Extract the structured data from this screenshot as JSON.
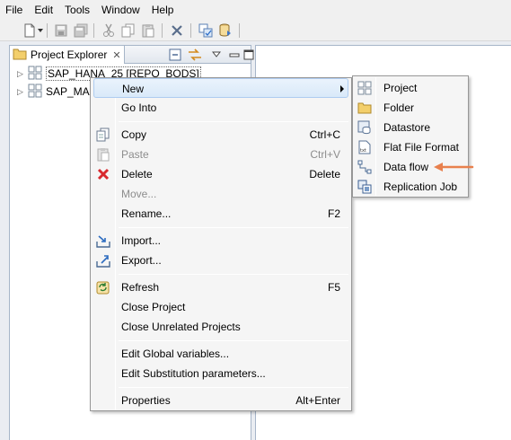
{
  "menubar": {
    "items": [
      "File",
      "Edit",
      "Tools",
      "Window",
      "Help"
    ]
  },
  "toolbar": {
    "icons": [
      "new-icon",
      "save-icon",
      "save-all-icon",
      "cut-icon",
      "copy-icon",
      "paste-icon",
      "delete-icon",
      "validate-icon",
      "database-icon"
    ]
  },
  "explorer": {
    "tab_label": "Project Explorer",
    "tree": [
      {
        "label": "SAP_HANA_25 [REPO_BODS]",
        "selected": true
      },
      {
        "label": "SAP_MA"
      }
    ]
  },
  "context_menu": {
    "items": {
      "new": {
        "label": "New"
      },
      "go_into": {
        "label": "Go Into"
      },
      "copy": {
        "label": "Copy",
        "shortcut": "Ctrl+C"
      },
      "paste": {
        "label": "Paste",
        "shortcut": "Ctrl+V"
      },
      "delete": {
        "label": "Delete",
        "shortcut": "Delete"
      },
      "move": {
        "label": "Move..."
      },
      "rename": {
        "label": "Rename...",
        "shortcut": "F2"
      },
      "import": {
        "label": "Import..."
      },
      "export": {
        "label": "Export..."
      },
      "refresh": {
        "label": "Refresh",
        "shortcut": "F5"
      },
      "close_project": {
        "label": "Close Project"
      },
      "close_unrelated": {
        "label": "Close Unrelated Projects"
      },
      "edit_global": {
        "label": "Edit Global variables..."
      },
      "edit_substitution": {
        "label": "Edit Substitution parameters..."
      },
      "properties": {
        "label": "Properties",
        "shortcut": "Alt+Enter"
      }
    }
  },
  "submenu": {
    "items": {
      "project": "Project",
      "folder": "Folder",
      "datastore": "Datastore",
      "flat_file": "Flat File Format",
      "data_flow": "Data flow",
      "replication_job": "Replication Job"
    }
  },
  "colors": {
    "highlight": "#d9e9f9",
    "annotation_arrow": "#e8804d",
    "delete_red": "#d8292e"
  }
}
